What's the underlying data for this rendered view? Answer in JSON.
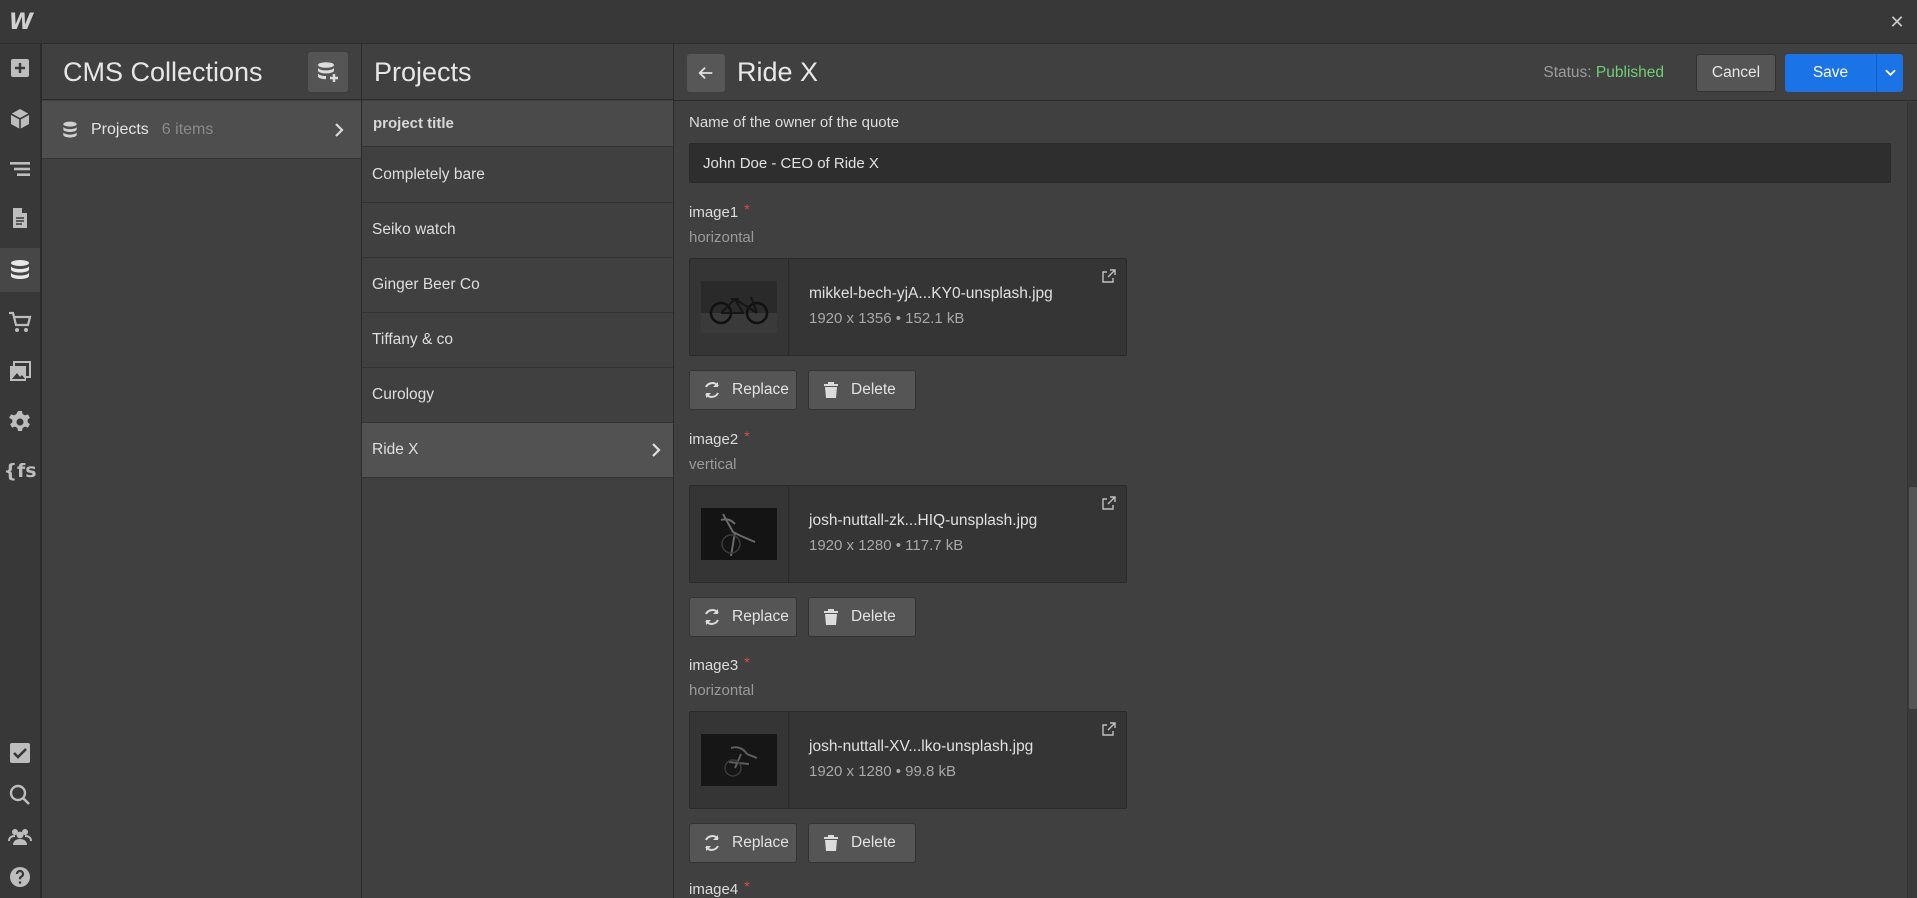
{
  "app": {
    "logo_text": "W",
    "close_glyph": "✕"
  },
  "leftbar": {
    "icons": [
      "add-icon",
      "cube-icon",
      "navigator-icon",
      "pages-icon",
      "database-icon",
      "cart-icon",
      "assets-icon",
      "gear-icon",
      "finsweet-icon",
      "audit-check-icon",
      "search-icon",
      "users-icon",
      "help-icon"
    ],
    "fs_label": "{fs"
  },
  "collections": {
    "title": "CMS Collections",
    "items": [
      {
        "name": "Projects",
        "count": "6 items"
      }
    ]
  },
  "items_panel": {
    "title": "Projects",
    "header": "project title",
    "items": [
      "Completely bare",
      "Seiko watch",
      "Ginger Beer Co",
      "Tiffany & co",
      "Curology",
      "Ride X"
    ],
    "selected": "Ride X"
  },
  "editor": {
    "title": "Ride X",
    "status_label": "Status:",
    "status_value": "Published",
    "cancel_label": "Cancel",
    "save_label": "Save",
    "quote_owner_label": "Name of the owner of the quote",
    "quote_owner_value": "John Doe - CEO of Ride X",
    "images": [
      {
        "label": "image1",
        "help": "horizontal",
        "file_name": "mikkel-bech-yjA...KY0-unsplash.jpg",
        "meta": "1920 x 1356 • 152.1 kB"
      },
      {
        "label": "image2",
        "help": "vertical",
        "file_name": "josh-nuttall-zk...HIQ-unsplash.jpg",
        "meta": "1920 x 1280 • 117.7 kB"
      },
      {
        "label": "image3",
        "help": "horizontal",
        "file_name": "josh-nuttall-XV...lko-unsplash.jpg",
        "meta": "1920 x 1280 • 99.8 kB"
      },
      {
        "label": "image4",
        "help": "",
        "file_name": "",
        "meta": ""
      }
    ],
    "replace_label": "Replace",
    "delete_label": "Delete",
    "required_mark": "*"
  },
  "colors": {
    "accent": "#1a74e8",
    "status_published": "#6fcf74",
    "required": "#e54848",
    "panel_bg": "#404040"
  }
}
